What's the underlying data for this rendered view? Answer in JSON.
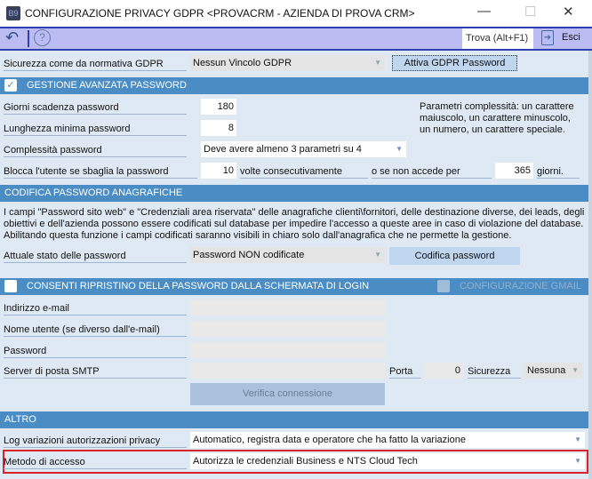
{
  "window": {
    "title": "CONFIGURAZIONE PRIVACY GDPR <PROVACRM - AZIENDA DI PROVA CRM>",
    "logo": "B9"
  },
  "toolbar": {
    "find": "Trova (Alt+F1)",
    "exit": "Esci"
  },
  "gdpr": {
    "label": "Sicurezza come da normativa GDPR",
    "value": "Nessun Vincolo GDPR",
    "button": "Attiva GDPR Password"
  },
  "adv": {
    "header": "GESTIONE AVANZATA PASSWORD",
    "checked": true,
    "expiry_label": "Giorni scadenza password",
    "expiry": "180",
    "minlen_label": "Lunghezza minima password",
    "minlen": "8",
    "complex_label": "Complessità password",
    "complex": "Deve avere almeno 3 parametri su 4",
    "info": "Parametri complessità: un carattere maiuscolo, un carattere minuscolo, un numero, un carattere speciale.",
    "block_label": "Blocca l'utente se sbaglia la password",
    "block_count": "10",
    "block_text": "volte consecutivamente",
    "inactive_text": "o se non accede per",
    "inactive_days": "365",
    "days": "giorni."
  },
  "encode": {
    "header": "CODIFICA PASSWORD ANAGRAFICHE",
    "paragraph": "I campi \"Password sito web\" e \"Credenziali area riservata\" delle anagrafiche clienti\\fornitori, delle destinazione diverse, dei leads, degli obiettivi e dell'azienda possono essere codificati sul database per impedire l'accesso a queste aree in caso di violazione del database. Abilitando questa funzione i campi codificati saranno visibili in chiaro solo dall'anagrafica che ne permette la gestione.",
    "state_label": "Attuale stato delle password",
    "state": "Password NON codificate",
    "button": "Codifica password"
  },
  "reset": {
    "header": "CONSENTI RIPRISTINO DELLA PASSWORD DALLA SCHERMATA DI LOGIN",
    "gmail": "CONFIGURAZIONE GMAIL",
    "email_label": "Indirizzo e-mail",
    "user_label": "Nome utente (se diverso dall'e-mail)",
    "password_label": "Password",
    "smtp_label": "Server di posta SMTP",
    "port_label": "Porta",
    "port": "0",
    "security_label": "Sicurezza",
    "security": "Nessuna",
    "verify": "Verifica connessione"
  },
  "other": {
    "header": "ALTRO",
    "log_label": "Log variazioni autorizzazioni privacy",
    "log": "Automatico, registra data e operatore che ha fatto la variazione",
    "access_label": "Metodo di accesso",
    "access": "Autorizza le credenziali Business e NTS Cloud Tech"
  }
}
